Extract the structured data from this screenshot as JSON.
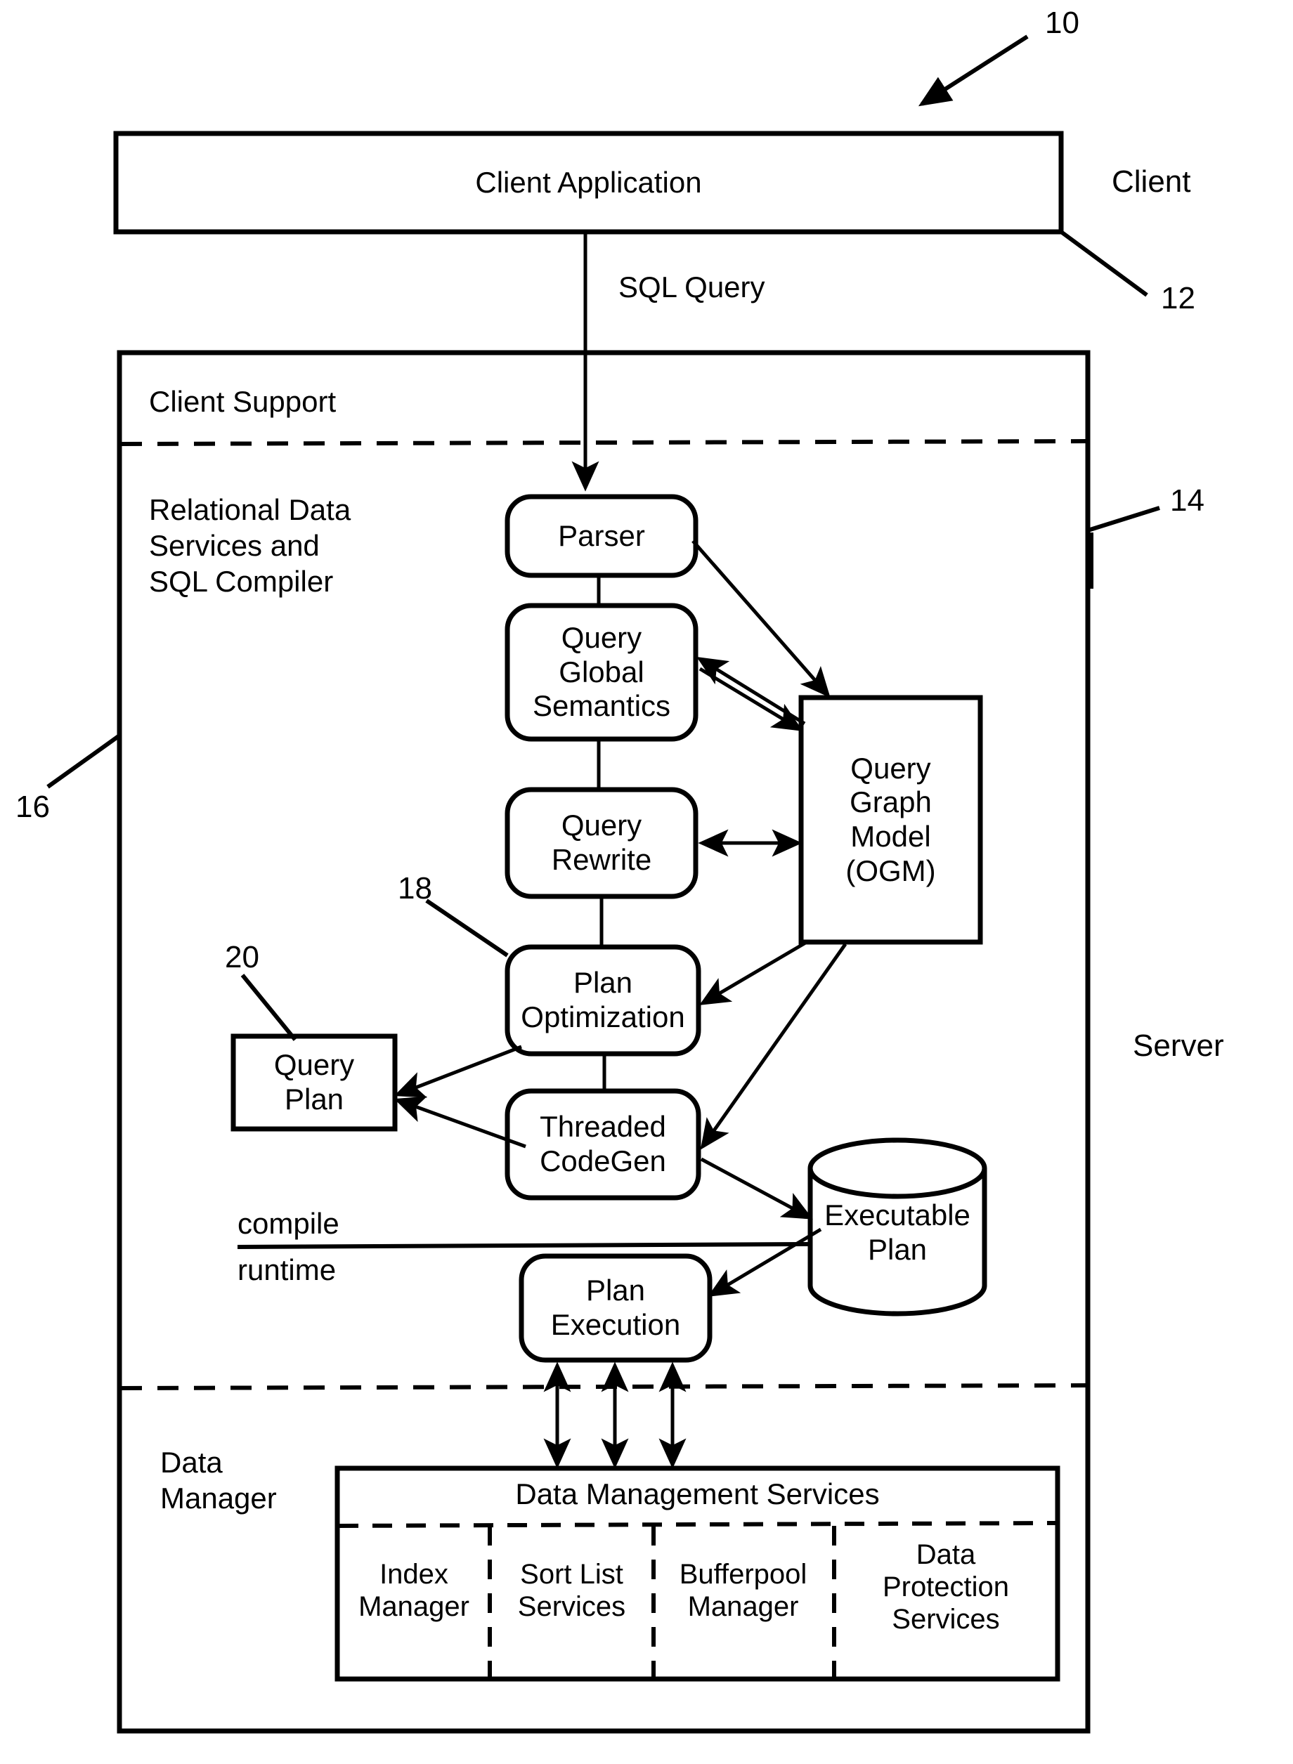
{
  "figure": {
    "reference_numerals": [
      {
        "id": "10",
        "label": "10"
      },
      {
        "id": "12",
        "label": "12"
      },
      {
        "id": "14",
        "label": "14"
      },
      {
        "id": "16",
        "label": "16"
      },
      {
        "id": "18",
        "label": "18"
      },
      {
        "id": "20",
        "label": "20"
      }
    ],
    "side_labels": {
      "client": "Client",
      "server": "Server"
    }
  },
  "client": {
    "application_box": "Client Application",
    "flow_label": "SQL Query"
  },
  "server": {
    "zones": {
      "client_support": "Client Support",
      "relational_data_services": "Relational Data\nServices and\nSQL Compiler",
      "data_manager": "Data\nManager"
    },
    "phase_divider": {
      "compile": "compile",
      "runtime": "runtime"
    },
    "nodes": [
      {
        "id": "parser",
        "label": "Parser",
        "shape": "rounded"
      },
      {
        "id": "query-global-semantics",
        "label": "Query\nGlobal\nSemantics",
        "shape": "rounded"
      },
      {
        "id": "query-rewrite",
        "label": "Query\nRewrite",
        "shape": "rounded"
      },
      {
        "id": "plan-optimization",
        "label": "Plan\nOptimization",
        "shape": "rounded"
      },
      {
        "id": "threaded-codegen",
        "label": "Threaded\nCodeGen",
        "shape": "rounded"
      },
      {
        "id": "plan-execution",
        "label": "Plan\nExecution",
        "shape": "rounded"
      },
      {
        "id": "query-graph-model",
        "label": "Query\nGraph\nModel\n(OGM)",
        "shape": "rect"
      },
      {
        "id": "query-plan",
        "label": "Query\nPlan",
        "shape": "rect"
      },
      {
        "id": "executable-plan",
        "label": "Executable\nPlan",
        "shape": "cylinder"
      }
    ],
    "data_management": {
      "title": "Data Management Services",
      "cells": [
        "Index\nManager",
        "Sort List\nServices",
        "Bufferpool\nManager",
        "Data\nProtection\nServices"
      ]
    }
  },
  "colors": {
    "ink": "#000000",
    "paper": "#ffffff"
  }
}
